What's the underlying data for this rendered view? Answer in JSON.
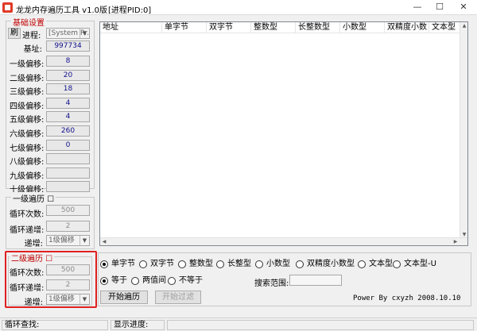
{
  "window": {
    "title": "龙龙内存遍历工具 v1.0版",
    "pid": "[进程PID:0]",
    "minimize": "—",
    "maximize": "☐",
    "close": "✕"
  },
  "basic": {
    "legend": "基础设置",
    "refresh_label": "刷",
    "process_label": "进程:",
    "process_value": "[System Pr...",
    "base_label": "基址:",
    "base_value": "997734",
    "offsets": [
      {
        "label": "一级偏移:",
        "value": "8"
      },
      {
        "label": "二级偏移:",
        "value": "20"
      },
      {
        "label": "三级偏移:",
        "value": "18"
      },
      {
        "label": "四级偏移:",
        "value": "4"
      },
      {
        "label": "五级偏移:",
        "value": "4"
      },
      {
        "label": "六级偏移:",
        "value": "260"
      },
      {
        "label": "七级偏移:",
        "value": "0"
      },
      {
        "label": "八级偏移:",
        "value": ""
      },
      {
        "label": "九级偏移:",
        "value": ""
      },
      {
        "label": "十级偏移:",
        "value": ""
      }
    ]
  },
  "level1": {
    "legend": "一级遍历",
    "loop_label": "循环次数:",
    "loop_value": "500",
    "inc_label": "循环递增:",
    "inc_value": "2",
    "target_label": "递增:",
    "target_value": "1级偏移"
  },
  "level2": {
    "legend": "二级遍历",
    "loop_label": "循环次数:",
    "loop_value": "500",
    "inc_label": "循环递增:",
    "inc_value": "2",
    "target_label": "递增:",
    "target_value": "1级偏移"
  },
  "table": {
    "columns": [
      "地址",
      "单字节",
      "双字节",
      "整数型",
      "长整数型",
      "小数型",
      "双精度小数",
      "文本型"
    ]
  },
  "types": [
    {
      "label": "单字节",
      "checked": true
    },
    {
      "label": "双字节",
      "checked": false
    },
    {
      "label": "整数型",
      "checked": false
    },
    {
      "label": "长整型",
      "checked": false
    },
    {
      "label": "小数型",
      "checked": false
    },
    {
      "label": "双精度小数型",
      "checked": false
    },
    {
      "label": "文本型",
      "checked": false
    },
    {
      "label": "文本型-U",
      "checked": false
    }
  ],
  "compare": [
    {
      "label": "等于",
      "checked": true
    },
    {
      "label": "两值间",
      "checked": false
    },
    {
      "label": "不等于",
      "checked": false
    }
  ],
  "search_range_label": "搜索范围:",
  "search_range_value": "",
  "start_button": "开始遍历",
  "filter_button": "开始过滤",
  "credit": "Power By cxyzh 2008.10.10",
  "status": {
    "loop_find": "循环查找:",
    "progress": "显示进度:"
  }
}
